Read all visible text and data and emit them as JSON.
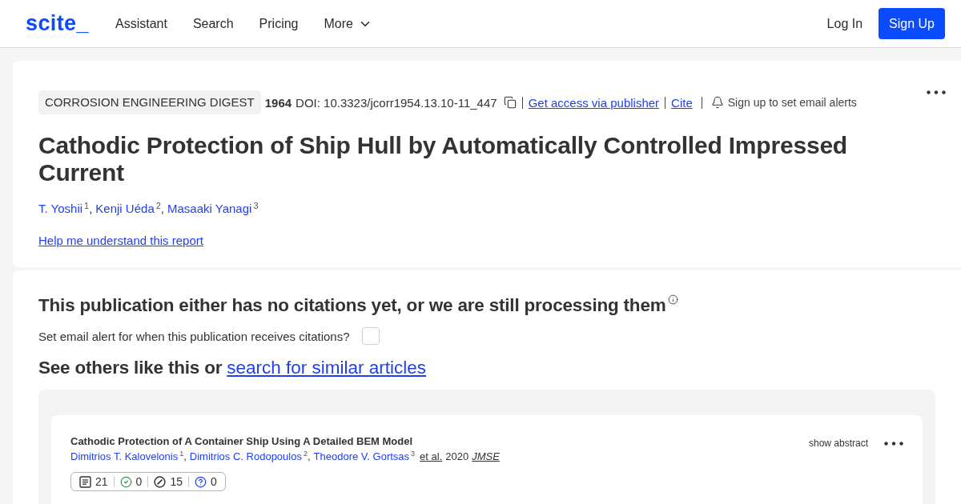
{
  "header": {
    "logo": "scite_",
    "nav": [
      {
        "label": "Assistant",
        "kind": "link"
      },
      {
        "label": "Search",
        "kind": "link"
      },
      {
        "label": "Pricing",
        "kind": "link"
      },
      {
        "label": "More",
        "kind": "dropdown"
      }
    ],
    "login": "Log In",
    "signup": "Sign Up"
  },
  "report": {
    "journal": "CORROSION ENGINEERING DIGEST",
    "year": "1964",
    "doi": "DOI: 10.3323/jcorr1954.13.10-11_447",
    "links": [
      "Get access via publisher",
      "Cite"
    ],
    "alert": "Sign up to set email alerts",
    "title": "Cathodic Protection of Ship Hull by Automatically Controlled Impressed Current",
    "authors": [
      {
        "name": "T. Yoshii",
        "index": "1"
      },
      {
        "name": "Kenji Uéda",
        "index": "2"
      },
      {
        "name": "Masaaki Yanagi",
        "index": "3"
      }
    ],
    "author_separator": ",",
    "help_link": "Help me understand this report"
  },
  "citations": {
    "heading": "This publication either has no citations yet, or we are still processing them",
    "email_alert": {
      "label": "Set email alert for when this publication receives citations?",
      "checked": false
    },
    "similar": {
      "text": "See others like this or",
      "link": "search for similar articles"
    }
  },
  "similar_articles": [
    {
      "title": "Cathodic Protection of A Container Ship Using A Detailed BEM Model",
      "authors": [
        {
          "name": "Dimitrios T. Kalovelonis",
          "index": "1"
        },
        {
          "name": "Dimitrios C. Rodopoulos",
          "index": "2"
        },
        {
          "name": "Theodore V. Gortsas",
          "index": "3"
        }
      ],
      "author_separator": ",",
      "et_al": "et al.",
      "year": "2020",
      "journal": "JMSE",
      "stats": [
        {
          "kind": "mentioning",
          "count": "21"
        },
        {
          "kind": "supporting",
          "count": "0"
        },
        {
          "kind": "contrasting",
          "count": "15"
        },
        {
          "kind": "unclassified",
          "count": "0"
        }
      ],
      "show_abstract": "show abstract"
    }
  ]
}
